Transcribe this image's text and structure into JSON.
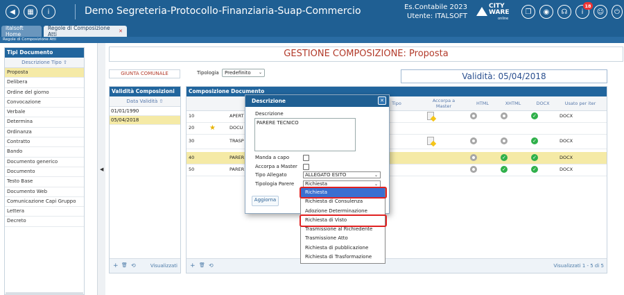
{
  "header": {
    "app_title": "Demo Segreteria-Protocollo-Finanziaria-Suap-Commercio",
    "es_contabile": "Es.Contabile 2023",
    "utente": "Utente: ITALSOFT",
    "brand_line1": "CITY",
    "brand_line2": "WARE",
    "brand_sub": "online",
    "notification_count": "18",
    "left_icons": [
      "arrow-left-icon",
      "grid-icon",
      "info-icon"
    ],
    "right_icons": [
      "windows-icon",
      "palette-icon",
      "headset-icon",
      "notifications-icon",
      "user-icon",
      "power-icon"
    ]
  },
  "tabs": [
    {
      "label": "italsoft Home"
    },
    {
      "label": "Regole di Composizione Atti"
    }
  ],
  "tab_close_glyph": "✕",
  "breadcrumb": "Regole di Composizione Atti",
  "left_panel": {
    "title": "Tipi Documento",
    "column": "Descrizione Tipo ⇧",
    "items": [
      "Proposta",
      "Delibera",
      "Ordine del giorno",
      "Convocazione",
      "Verbale",
      "Determina",
      "Ordinanza",
      "Contratto",
      "Bando",
      "Documento generico",
      "Documento",
      "Testo Base",
      "Documento Web",
      "Comunicazione Capi Gruppo",
      "Lettera",
      "Decreto"
    ],
    "selected_index": 0
  },
  "main": {
    "title": "GESTIONE COMPOSIZIONE: Proposta",
    "office": "GIUNTA COMUNALE",
    "tipologia_label": "Tipologia",
    "tipologia_value": "Predefinito",
    "validita": "Validità: 05/04/2018"
  },
  "valid_panel": {
    "title": "Validità Composizioni",
    "column": "Data Validità ⇧",
    "rows": [
      "01/01/1990",
      "05/04/2018"
    ],
    "selected_index": 1,
    "footer_add": "+",
    "footer_delete": "🗑",
    "footer_refresh": "⟲",
    "footer_label": "Visualizzati"
  },
  "comp_panel": {
    "title": "Composizione Documento",
    "columns": {
      "tipo": "Tipo",
      "accorpa": "Accorpa a Master",
      "html": "HTML",
      "xhtml": "XHTML",
      "docx": "DOCX",
      "usato": "Usato per iter"
    },
    "rows": [
      {
        "seq": "10",
        "desc": "APERT",
        "usato": "DOCX"
      },
      {
        "seq": "20",
        "desc": "DOCU",
        "usato": ""
      },
      {
        "seq": "30",
        "desc": "TRASP",
        "usato": "DOCX"
      },
      {
        "seq": "40",
        "desc": "PARER",
        "usato": "DOCX"
      },
      {
        "seq": "50",
        "desc": "PARER",
        "usato": "DOCX"
      }
    ],
    "footer_add": "+",
    "footer_delete": "🗑",
    "footer_refresh": "⟲",
    "footer_label": "Visualizzati 1 - 5 di 5"
  },
  "dialog": {
    "title": "Descrizione",
    "close_glyph": "✕",
    "descrizione_label": "Descrizione",
    "descrizione_value": "PARERE TECNICO",
    "manda_a_capo_label": "Manda a capo",
    "accorpa_label": "Accorpa a Master",
    "tipo_allegato_label": "Tipo Allegato",
    "tipo_allegato_value": "ALLEGATO ESITO",
    "tipologia_parere_label": "Tipologia Parere",
    "tipologia_parere_value": "Richiesta",
    "update_button": "Aggiorna"
  },
  "dropdown": {
    "options": [
      "Richiesta",
      "Richiesta di Consulenza",
      "Adozione Determinazione",
      "Richiesta di Visto",
      "Trasmissione al Richiedente",
      "Trasmissione Atto",
      "Richiesta di pubblicazione",
      "Richiesta di Trasformazione"
    ],
    "highlighted_index": 0,
    "circled_options": [
      "Richiesta",
      "Richiesta di Visto"
    ]
  },
  "colors": {
    "header": "#1f5f93",
    "accent_red": "#b23a2a",
    "highlight": "#3a6fd1",
    "selected_row": "#f5eaa6",
    "annotation_ring": "#e02020"
  }
}
